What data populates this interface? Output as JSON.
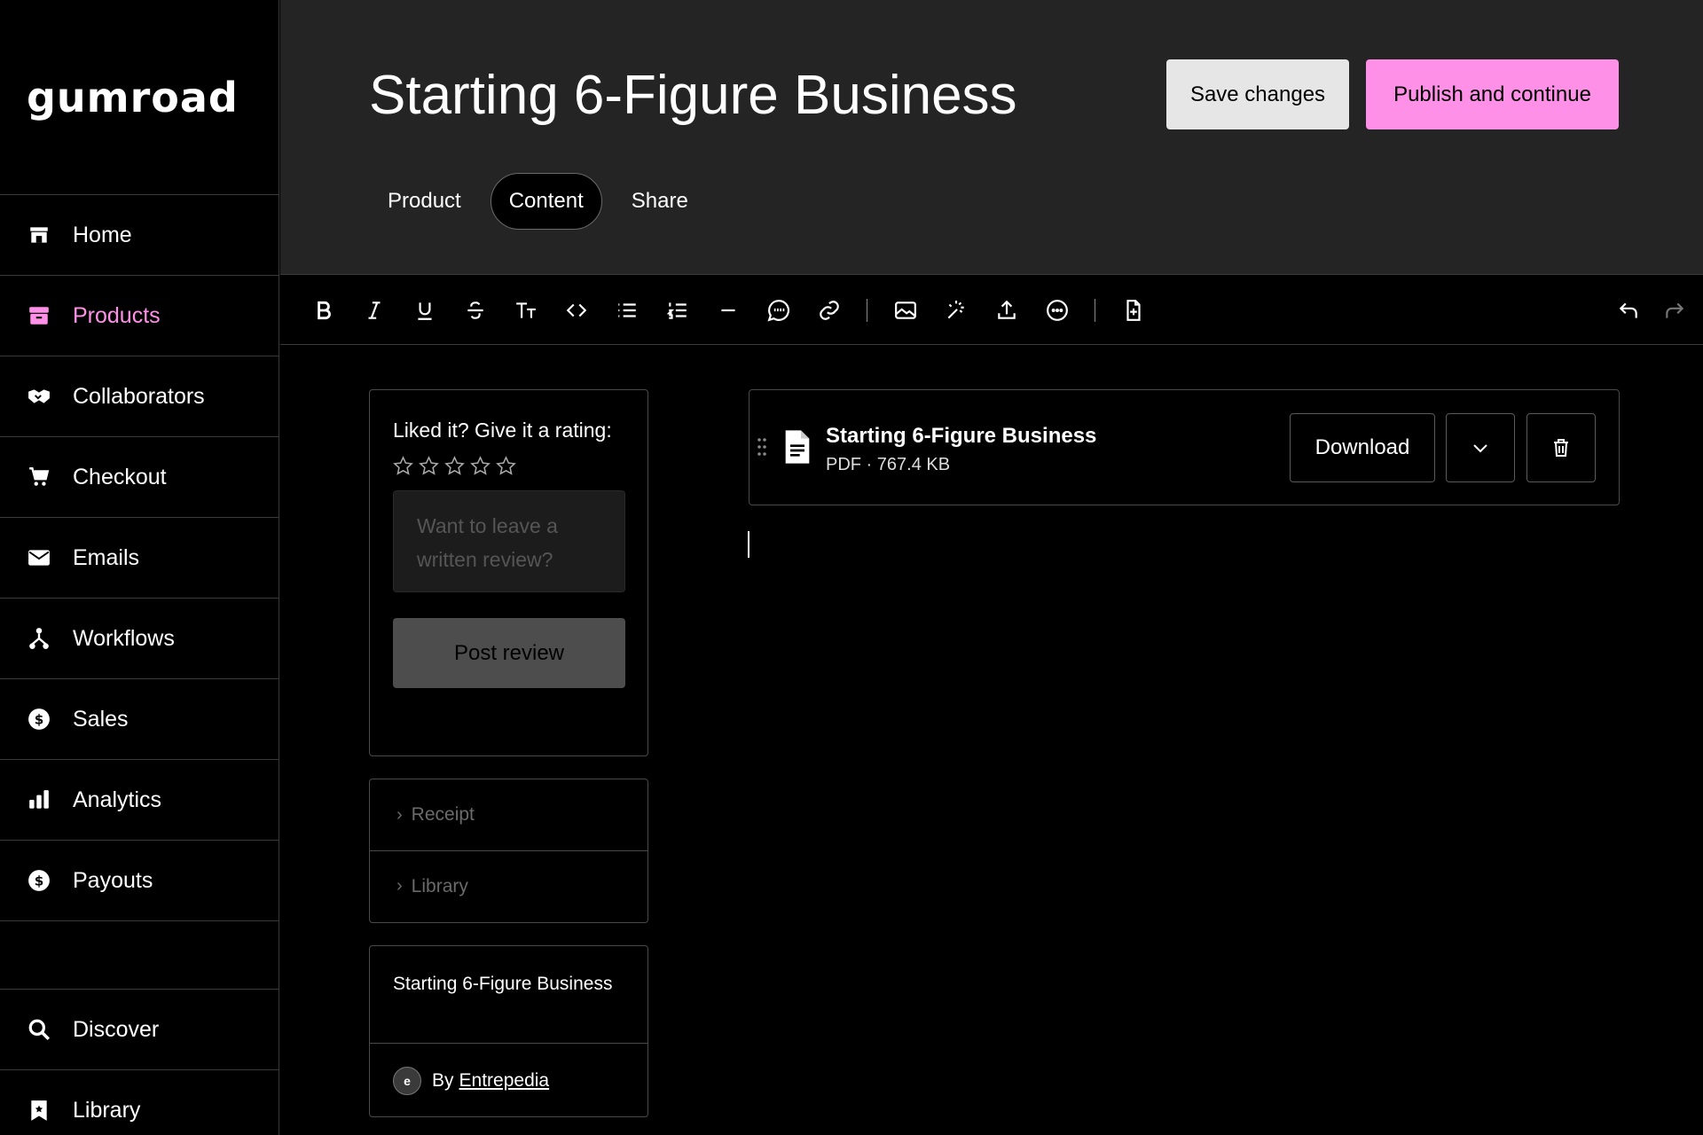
{
  "brand": {
    "logo_text": "Gumroad",
    "accent": "#ff90e8"
  },
  "sidebar": {
    "items": [
      {
        "label": "Home",
        "icon": "store-icon"
      },
      {
        "label": "Products",
        "icon": "archive-icon",
        "active": true
      },
      {
        "label": "Collaborators",
        "icon": "handshake-icon"
      },
      {
        "label": "Checkout",
        "icon": "cart-icon"
      },
      {
        "label": "Emails",
        "icon": "envelope-icon"
      },
      {
        "label": "Workflows",
        "icon": "workflow-icon"
      },
      {
        "label": "Sales",
        "icon": "dollar-circle-icon"
      },
      {
        "label": "Analytics",
        "icon": "bar-chart-icon"
      },
      {
        "label": "Payouts",
        "icon": "dollar-circle-icon"
      }
    ],
    "bottom_items": [
      {
        "label": "Discover",
        "icon": "search-icon"
      },
      {
        "label": "Library",
        "icon": "bookmark-icon"
      }
    ]
  },
  "header": {
    "title": "Starting 6-Figure Business",
    "save_label": "Save changes",
    "publish_label": "Publish and continue",
    "tabs": [
      {
        "label": "Product"
      },
      {
        "label": "Content",
        "active": true
      },
      {
        "label": "Share"
      }
    ]
  },
  "toolbar": {
    "tools": [
      "bold-icon",
      "italic-icon",
      "underline-icon",
      "strikethrough-icon",
      "text-size-icon",
      "code-icon",
      "bullet-list-icon",
      "numbered-list-icon",
      "horizontal-rule-icon",
      "quote-icon",
      "link-icon",
      "image-icon",
      "sparkle-icon",
      "upload-icon",
      "more-icon",
      "add-file-icon",
      "undo-icon",
      "redo-icon"
    ]
  },
  "review": {
    "prompt": "Liked it? Give it a rating:",
    "rating": 0,
    "max_rating": 5,
    "placeholder": "Want to leave a written review?",
    "post_label": "Post review"
  },
  "accordion": [
    {
      "label": "Receipt"
    },
    {
      "label": "Library"
    }
  ],
  "product_card": {
    "name": "Starting 6-Figure Business",
    "by_label": "By",
    "author": "Entrepedia",
    "avatar_initial": "e"
  },
  "file": {
    "name": "Starting 6-Figure Business",
    "meta": "PDF · 767.4 KB",
    "download_label": "Download"
  }
}
